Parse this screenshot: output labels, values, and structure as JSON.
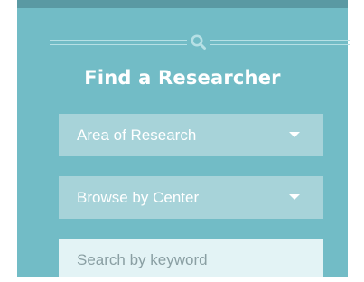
{
  "widget": {
    "title": "Find a Researcher",
    "header_icon": "search-icon",
    "colors": {
      "panel_background": "#72bcc6",
      "top_border": "#5a99a3",
      "select_background": "#a7d3d9",
      "input_background": "#e3f3f5",
      "text": "#ffffff"
    }
  },
  "filters": {
    "area_of_research": {
      "label": "Area of Research",
      "icon": "chevron-down-icon"
    },
    "browse_by_center": {
      "label": "Browse by Center",
      "icon": "chevron-down-icon"
    }
  },
  "search": {
    "placeholder": "Search by keyword",
    "value": ""
  }
}
